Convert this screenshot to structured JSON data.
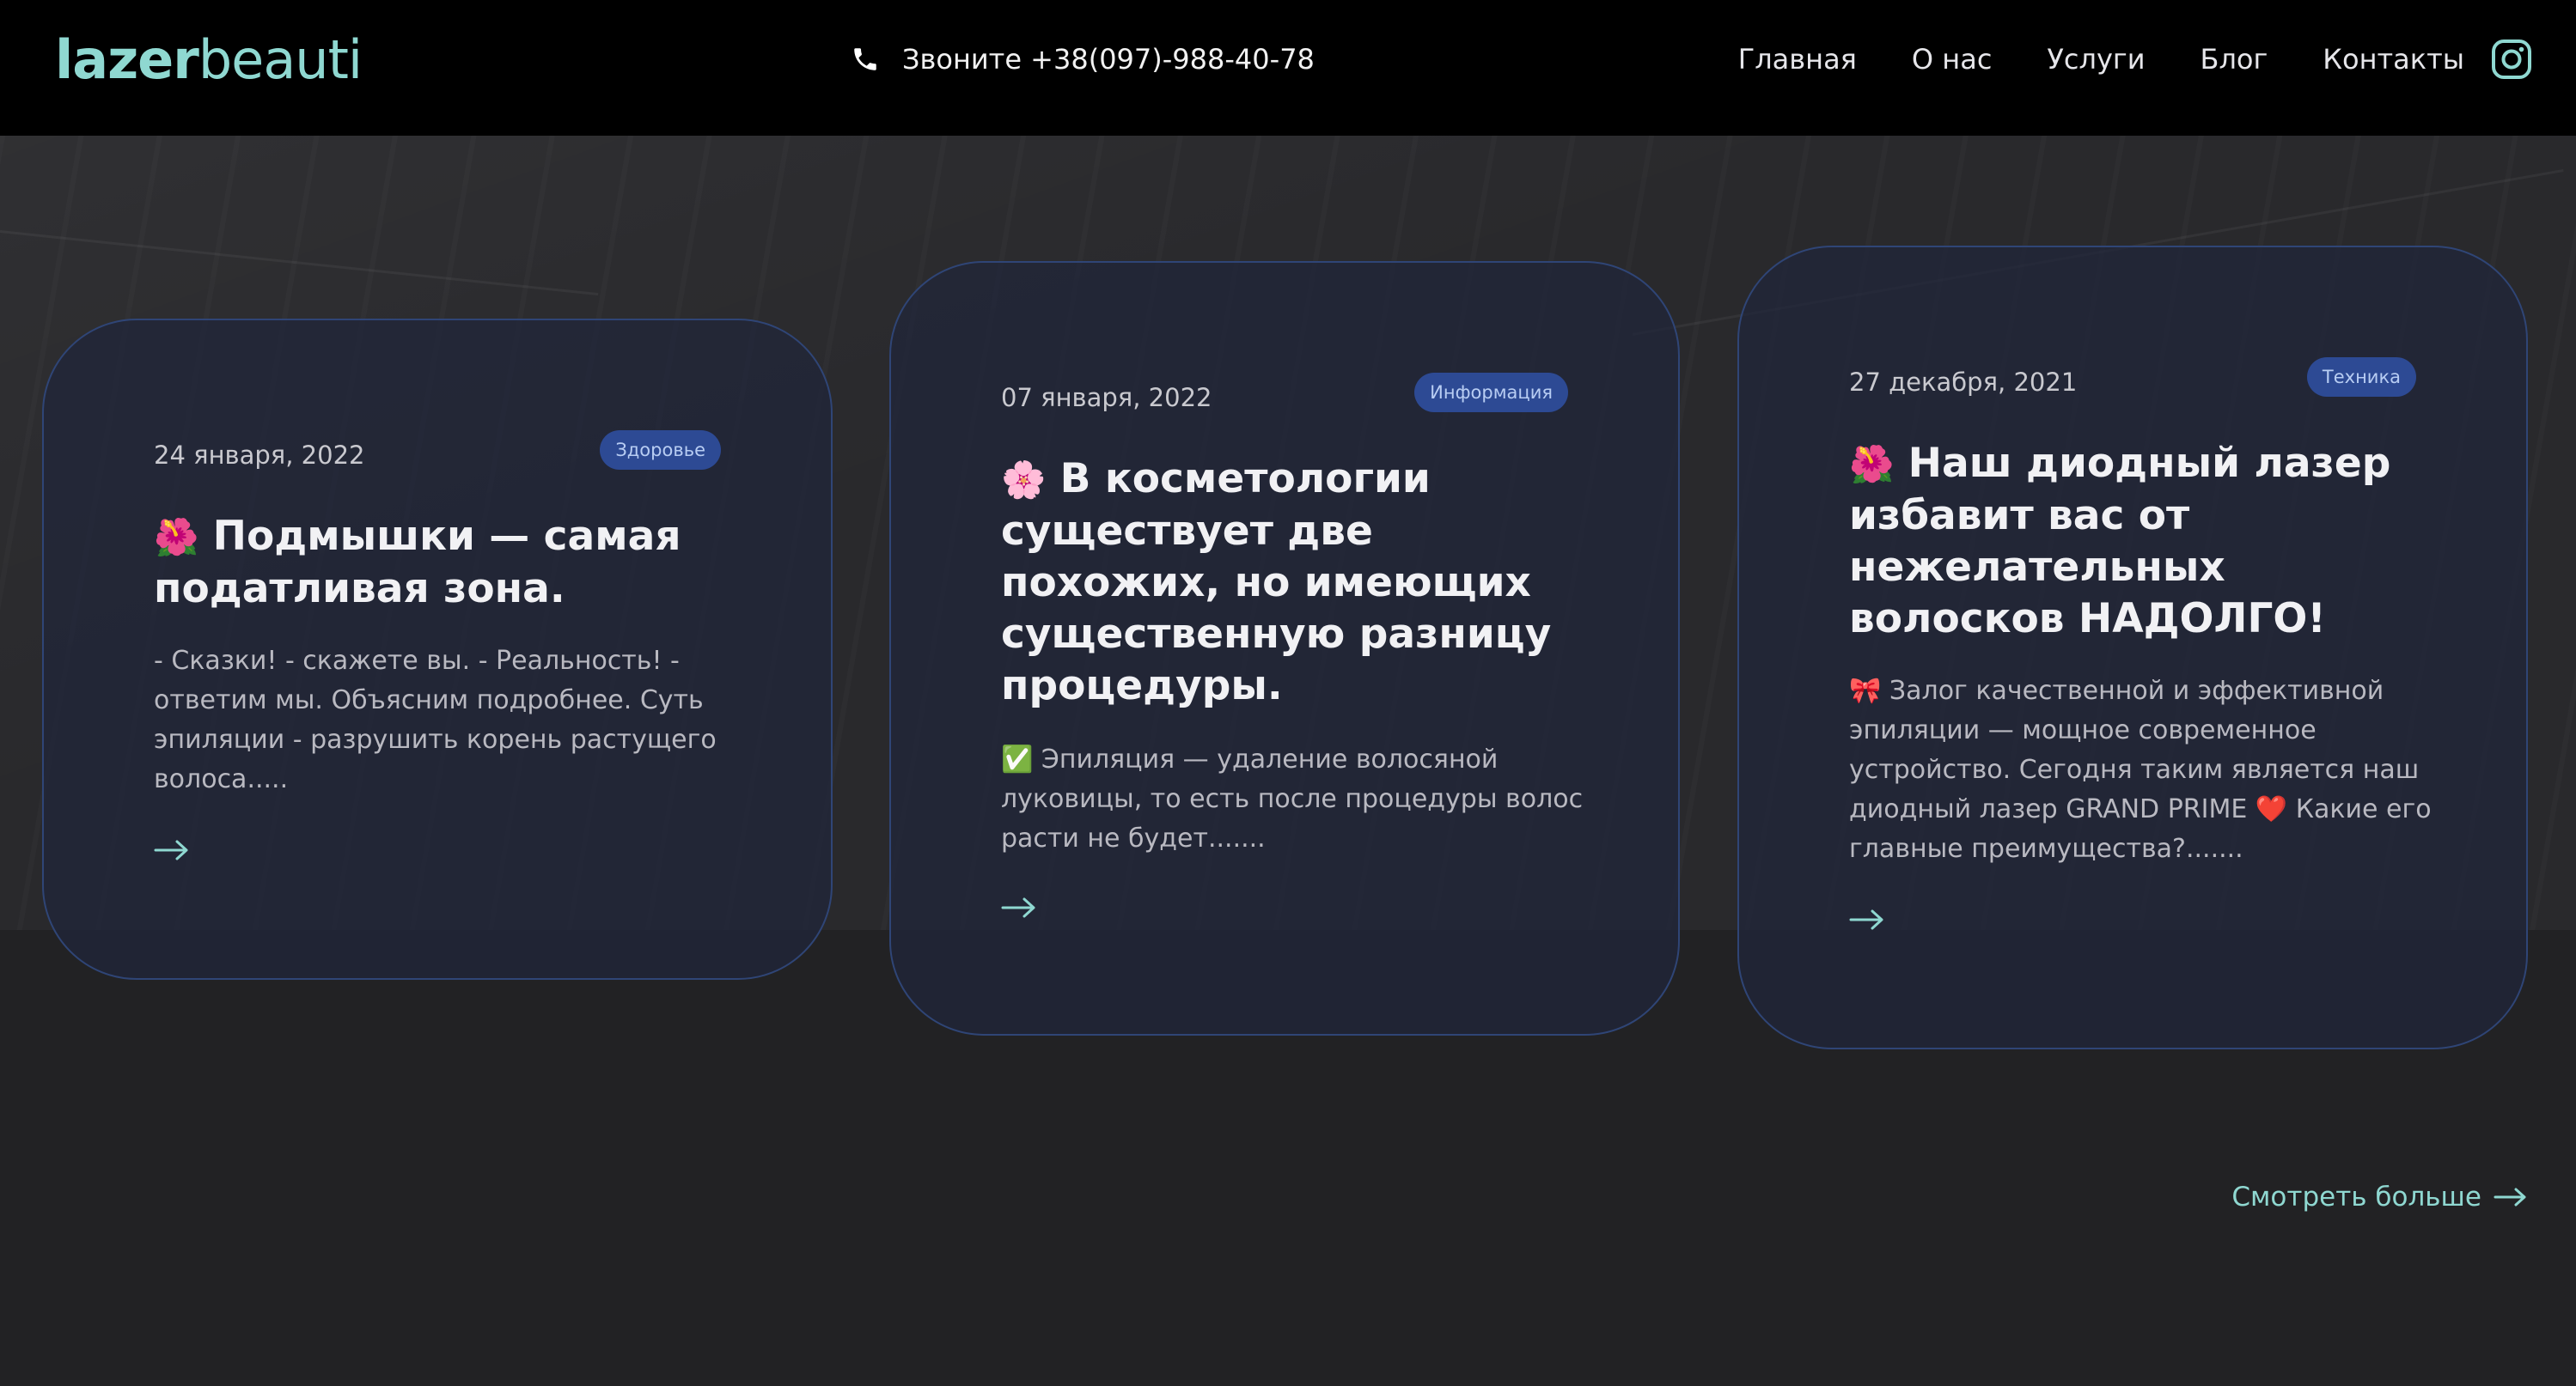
{
  "header": {
    "logo_bold": "lazer",
    "logo_light": "beauti",
    "phone_text": "Звоните +38(097)-988-40-78",
    "phone_icon": "phone-icon",
    "nav": [
      "Главная",
      "О нас",
      "Услуги",
      "Блог",
      "Контакты"
    ],
    "social_icon": "instagram-icon"
  },
  "cards": [
    {
      "date": "24 января, 2022",
      "tag": "Здоровье",
      "emoji": "🌺",
      "title": "Подмышки — самая податливая зона.",
      "excerpt": "- Сказки! - скажете вы. - Реальность! - ответим мы. Объясним подробнее. Суть эпиляции - разрушить корень растущего волоса.....",
      "arrow_icon": "arrow-right-icon"
    },
    {
      "date": "07 января, 2022",
      "tag": "Информация",
      "emoji": "🌸",
      "title": "В косметологии существует две похожих, но имеющих существенную разницу процедуры.",
      "excerpt_emoji": "✅",
      "excerpt": "Эпиляция — удаление волосяной луковицы, то есть после процедуры волос расти не будет.......",
      "arrow_icon": "arrow-right-icon"
    },
    {
      "date": "27 декабря, 2021",
      "tag": "Техника",
      "emoji": "🌺",
      "title": "Наш диодный лазер избавит вас от нежелательных волосков НАДОЛГО!",
      "excerpt_emoji": "🎀",
      "excerpt": "Залог качественной и эффективной эпиляции — мощное современное устройство. Сегодня таким является наш диодный лазер GRAND PRIME ❤️ Какие его главные преимущества?.......",
      "arrow_icon": "arrow-right-icon"
    }
  ],
  "more_link": "Смотреть больше",
  "colors": {
    "accent": "#8fd8d1",
    "card_border": "#2f4576",
    "badge_bg": "#2d4a94",
    "header_bg": "#000000",
    "page_bg": "#222224"
  }
}
